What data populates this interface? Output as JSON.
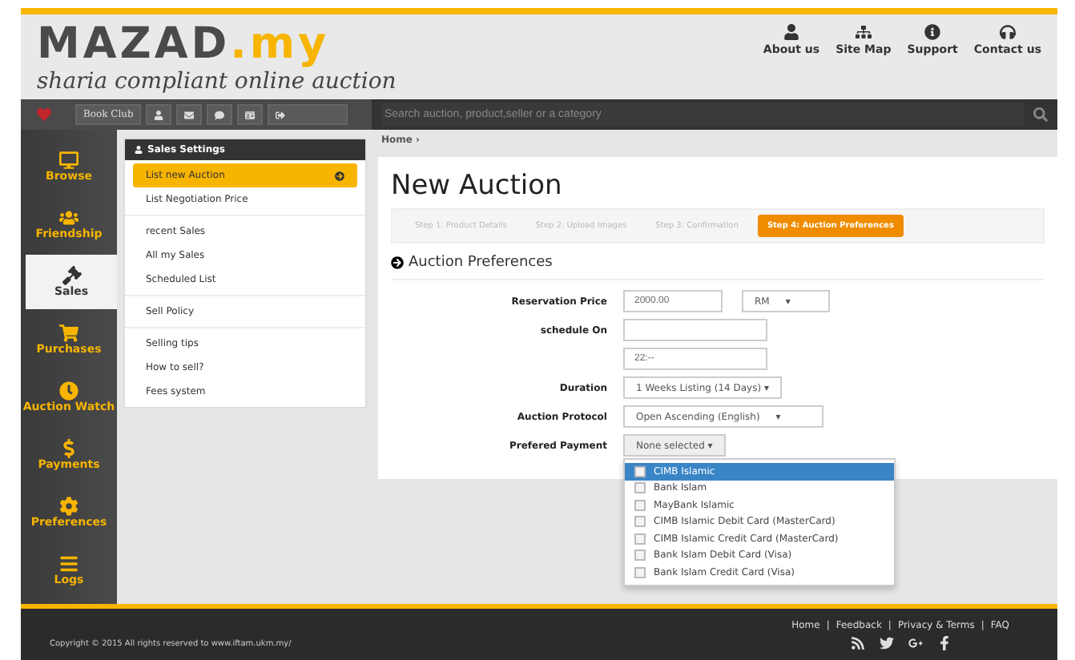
{
  "header": {
    "logo_main": "MAZAD",
    "logo_suffix": ".my",
    "tagline": "sharia compliant online auction",
    "links": [
      {
        "kind": "user",
        "label": "About us"
      },
      {
        "kind": "sitemap",
        "label": "Site Map"
      },
      {
        "kind": "info",
        "label": "Support"
      },
      {
        "kind": "headset",
        "label": "Contact us"
      }
    ]
  },
  "toolbar": {
    "club_button": "Book Club",
    "search": {
      "placeholder": "Search auction, product,seller or a category"
    }
  },
  "sidebar": {
    "items": [
      {
        "kind": "monitor",
        "label": "Browse",
        "selected": false
      },
      {
        "kind": "people",
        "label": "Friendship",
        "selected": false
      },
      {
        "kind": "gavel",
        "label": "Sales",
        "selected": true
      },
      {
        "kind": "cart",
        "label": "Purchases",
        "selected": false
      },
      {
        "kind": "watch",
        "label": "Auction Watch",
        "selected": false
      },
      {
        "kind": "dollar",
        "label": "Payments",
        "selected": false
      },
      {
        "kind": "gear",
        "label": "Preferences",
        "selected": false
      },
      {
        "kind": "lines",
        "label": "Logs",
        "selected": false
      }
    ]
  },
  "settings_menu": {
    "title": "Sales Settings",
    "groups": [
      [
        {
          "label": "List new Auction",
          "selected": true
        },
        {
          "label": "List Negotiation Price",
          "selected": false
        }
      ],
      [
        {
          "label": "recent Sales",
          "selected": false
        },
        {
          "label": "All my Sales",
          "selected": false
        },
        {
          "label": "Scheduled List",
          "selected": false
        }
      ],
      [
        {
          "label": "Sell Policy",
          "selected": false
        }
      ],
      [
        {
          "label": "Selling tips",
          "selected": false
        },
        {
          "label": "How to sell?",
          "selected": false
        },
        {
          "label": "Fees system",
          "selected": false
        }
      ]
    ]
  },
  "breadcrumb": "Home ›",
  "page_title": "New Auction",
  "steps": [
    {
      "label": "Step 1: Product Details",
      "selected": false
    },
    {
      "label": "Step 2: Upload Images",
      "selected": false
    },
    {
      "label": "Step 3: Confirmation",
      "selected": false
    },
    {
      "label": "Step 4: Auction Preferences",
      "selected": true
    }
  ],
  "section_title": "Auction Preferences",
  "form": [
    {
      "kind": "price",
      "label": "Reservation Price",
      "value": "2000.00",
      "currency": "RM",
      "caret": "▾"
    },
    {
      "kind": "text",
      "label": "schedule On"
    },
    {
      "kind": "text",
      "value": "22:--"
    },
    {
      "kind": "dropdown",
      "label": "Duration",
      "value": "1 Weeks Listing (14 Days) ▾"
    },
    {
      "kind": "select",
      "label": "Auction Protocol",
      "value": "Open Ascending (English)",
      "caret": "▾"
    },
    {
      "kind": "multiselect",
      "label": "Prefered Payment",
      "value": "None selected ▾"
    }
  ],
  "payment_options": [
    {
      "label": "CIMB Islamic",
      "checked": false,
      "selected": true
    },
    {
      "label": "Bank Islam",
      "checked": false,
      "selected": false
    },
    {
      "label": "MayBank Islamic",
      "checked": false,
      "selected": false
    },
    {
      "label": "CIMB Islamic Debit Card (MasterCard)",
      "checked": false,
      "selected": false
    },
    {
      "label": "CIMB Islamic Credit Card (MasterCard)",
      "checked": false,
      "selected": false
    },
    {
      "label": "Bank Islam Debit Card (Visa)",
      "checked": false,
      "selected": false
    },
    {
      "label": "Bank Islam Credit Card (Visa)",
      "checked": false,
      "selected": false
    }
  ],
  "footer": {
    "copyright": "Copyright © 2015 All rights reserved to www.iftam.ukm.my/",
    "links": [
      "Home",
      "Feedback",
      "Privacy & Terms",
      "FAQ"
    ],
    "separator": "|"
  }
}
